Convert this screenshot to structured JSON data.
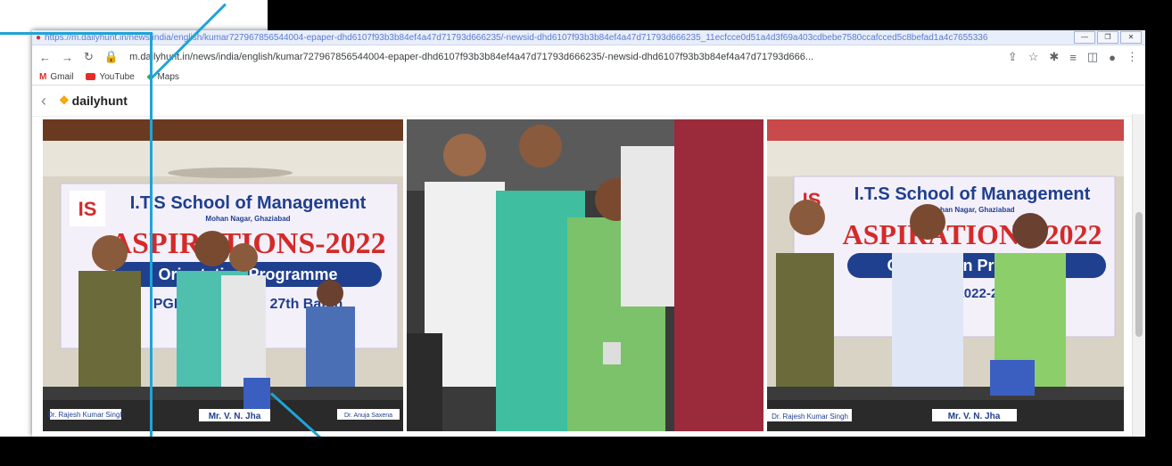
{
  "browser": {
    "title_url": "https://m.dailyhunt.in/news/india/english/kumar727967856544004-epaper-dhd6107f93b3b84ef4a47d71793d666235/-newsid-dhd6107f93b3b84ef4a47d71793d666235_11ecfcce0d51a4d3f69a403cdbebe7580ccafcced5c8befad1a4c7655336",
    "address": "m.dailyhunt.in/news/india/english/kumar727967856544004-epaper-dhd6107f93b3b84ef4a47d71793d666235/-newsid-dhd6107f93b3b84ef4a47d71793d666...",
    "window_buttons": [
      "—",
      "❐",
      "✕"
    ],
    "bookmarks": [
      "Gmail",
      "YouTube",
      "Maps"
    ]
  },
  "site": {
    "logo_text": "dailyhunt"
  },
  "photos": {
    "left": {
      "banner_title": "I.T.S School of Management",
      "banner_sub": "Mohan Nagar, Ghaziabad",
      "event": "ASPIRATIONS-2022",
      "program": "Orientation Programme",
      "batch": "PGDM (2022-24), 27th Batch",
      "nameplate_1": "Dr. Rajesh Kumar Singh",
      "nameplate_2": "Mr. V. N. Jha",
      "nameplate_3": "Dr. Anuja Saxena"
    },
    "right": {
      "banner_title": "I.T.S School of Management",
      "banner_sub": "Mohan Nagar, Ghaziabad",
      "event": "ASPIRATIONS-2022",
      "program": "Orientation Programme",
      "batch": "PGDM (2022-24), 27th",
      "nameplate_1": "Dr. Rajesh Kumar Singh",
      "nameplate_2": "Mr. V. N. Jha"
    }
  },
  "colors": {
    "callout": "#1fa4d8",
    "banner_blue": "#1f3f8f",
    "banner_red": "#d42a2a"
  }
}
